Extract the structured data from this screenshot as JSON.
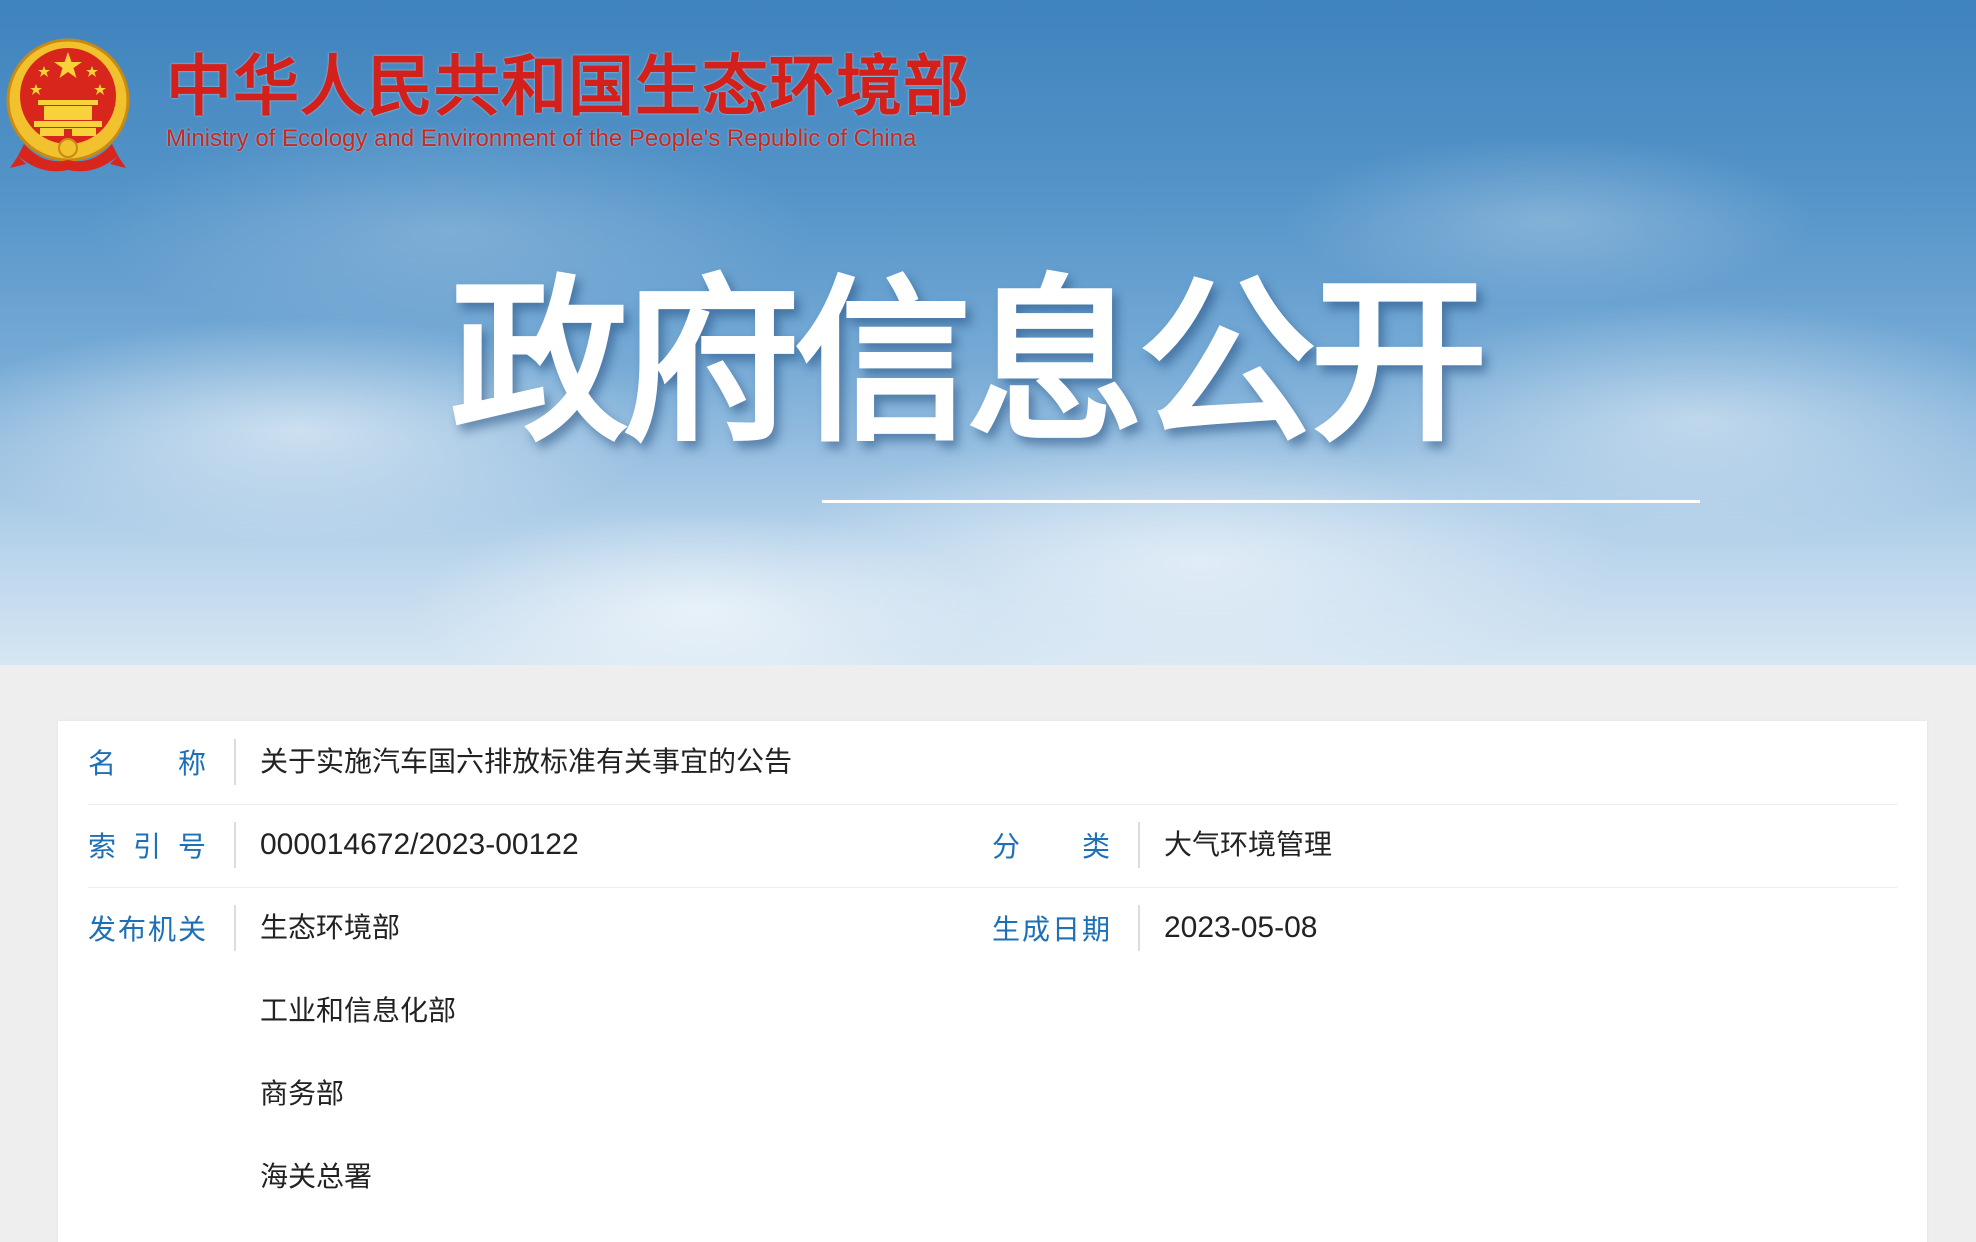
{
  "header": {
    "ministry_name_cn": "中华人民共和国生态环境部",
    "ministry_name_en": "Ministry of Ecology and Environment of the People's Republic of China",
    "banner_title": "政府信息公开",
    "emblem_icon": "national-emblem-icon"
  },
  "info": {
    "name": {
      "label_chars": [
        "名",
        "称"
      ],
      "value": "关于实施汽车国六排放标准有关事宜的公告"
    },
    "index_no": {
      "label_chars": [
        "索",
        "引",
        "号"
      ],
      "value": "000014672/2023-00122"
    },
    "category": {
      "label_chars": [
        "分",
        "类"
      ],
      "value": "大气环境管理"
    },
    "issuer": {
      "label_chars": [
        "发",
        "布",
        "机",
        "关"
      ],
      "values": [
        "生态环境部",
        "工业和信息化部",
        "商务部",
        "海关总署"
      ]
    },
    "date": {
      "label_chars": [
        "生",
        "成",
        "日",
        "期"
      ],
      "value": "2023-05-08"
    }
  },
  "colors": {
    "label": "#1d6fb8",
    "ministry_red": "#d4201a",
    "emblem_gold": "#f2c12e",
    "emblem_red": "#d9261c"
  }
}
